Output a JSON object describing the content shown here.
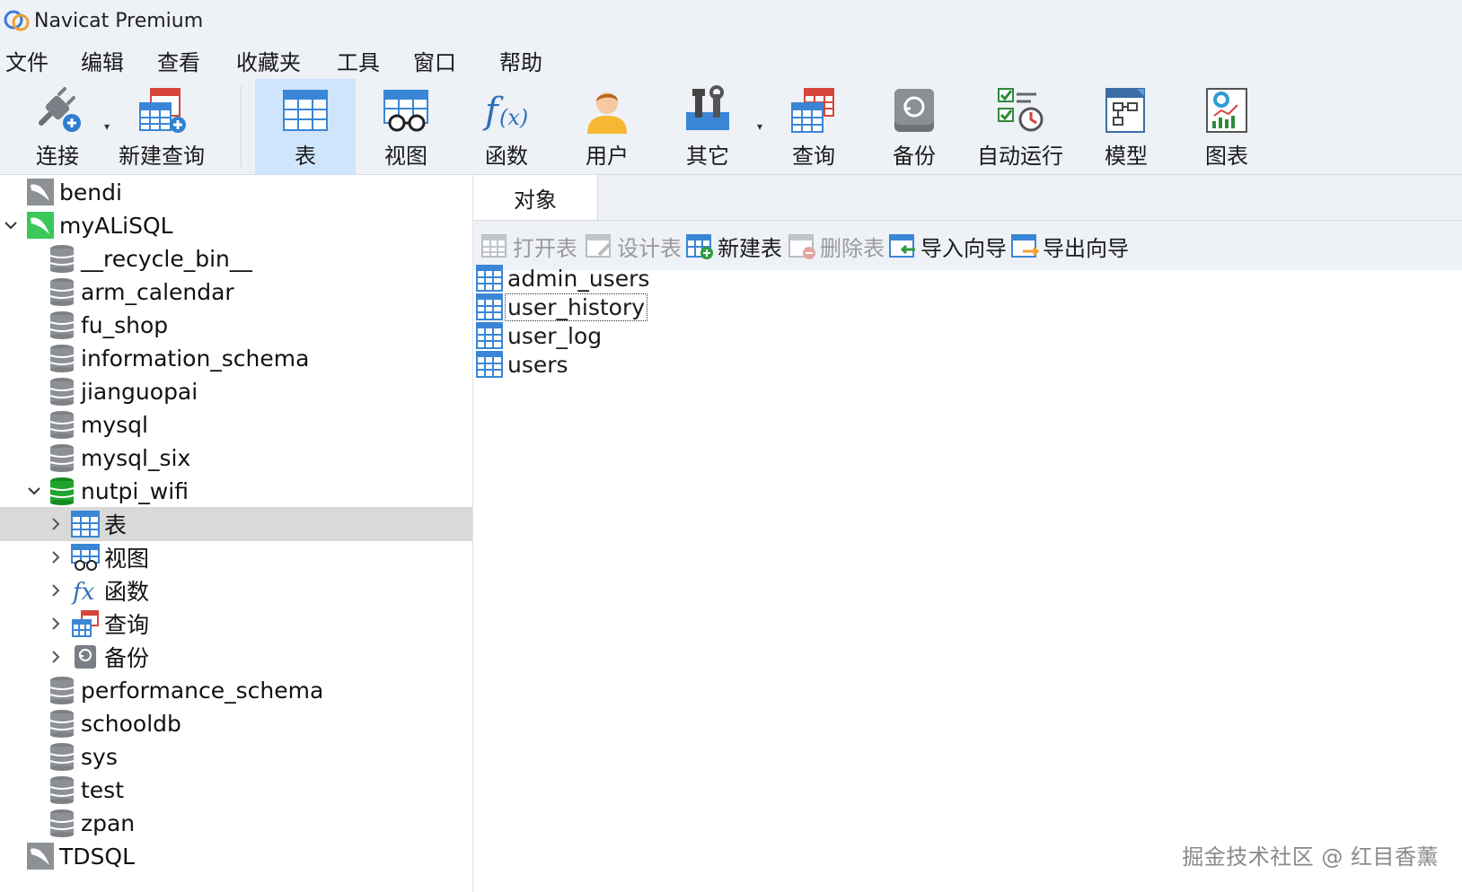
{
  "window": {
    "title": "Navicat Premium"
  },
  "menu": [
    "文件",
    "编辑",
    "查看",
    "收藏夹",
    "工具",
    "窗口",
    "帮助"
  ],
  "toolbar": {
    "connect": "连接",
    "new_query": "新建查询",
    "table": "表",
    "view": "视图",
    "function": "函数",
    "user": "用户",
    "other": "其它",
    "query": "查询",
    "backup": "备份",
    "automation": "自动运行",
    "model": "模型",
    "chart": "图表",
    "active": "表"
  },
  "sidebar": {
    "connections": [
      {
        "name": "bendi",
        "expanded": false
      },
      {
        "name": "myALiSQL",
        "expanded": true
      },
      {
        "name": "TDSQL",
        "expanded": false
      }
    ],
    "databases": [
      "__recycle_bin__",
      "arm_calendar",
      "fu_shop",
      "information_schema",
      "jianguopai",
      "mysql",
      "mysql_six",
      "nutpi_wifi",
      "performance_schema",
      "schooldb",
      "sys",
      "test",
      "zpan"
    ],
    "open_database": "nutpi_wifi",
    "nodes": [
      "表",
      "视图",
      "函数",
      "查询",
      "备份"
    ],
    "selected_node": "表"
  },
  "objects_tab": {
    "label": "对象"
  },
  "object_toolbar": {
    "open_table": "打开表",
    "design_table": "设计表",
    "new_table": "新建表",
    "delete_table": "删除表",
    "import_wizard": "导入向导",
    "export_wizard": "导出向导"
  },
  "tables": [
    "admin_users",
    "user_history",
    "user_log",
    "users"
  ],
  "focused_table": "user_history",
  "watermark": "掘金技术社区 @ 红目香薰",
  "colors": {
    "chrome_bg": "#eef1f6",
    "active_tool": "#cfe5fb",
    "selected_row": "#d9d9d9",
    "table_icon_blue": "#3a86d6",
    "connection_green": "#3cc75a",
    "db_green": "#1fa52e"
  }
}
